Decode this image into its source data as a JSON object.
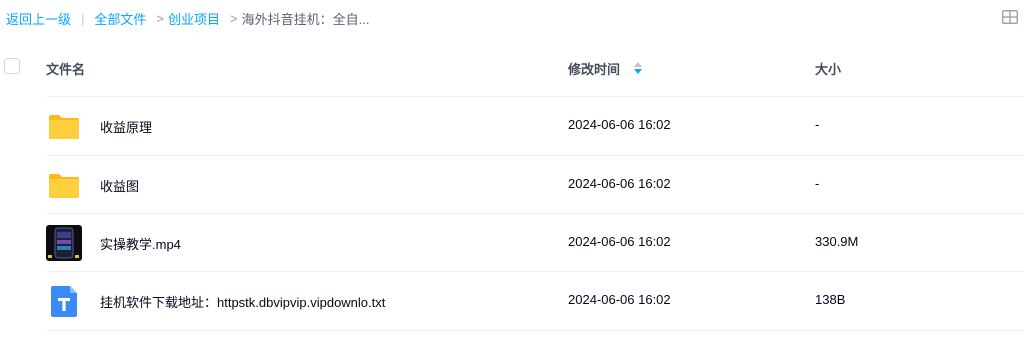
{
  "breadcrumb": {
    "back": "返回上一级",
    "sep": "|",
    "all_files": "全部文件",
    "gt": ">",
    "folder1": "创业项目",
    "current": "海外抖音挂机：全自..."
  },
  "view_toggle_icon": "grid-view-icon",
  "table": {
    "columns": {
      "name": "文件名",
      "modified": "修改时间",
      "size": "大小"
    },
    "sort_icon": "sort-toggle-icon",
    "rows": [
      {
        "icon": "folder-icon",
        "name": "收益原理",
        "modified": "2024-06-06 16:02",
        "size": "-"
      },
      {
        "icon": "folder-icon",
        "name": "收益图",
        "modified": "2024-06-06 16:02",
        "size": "-"
      },
      {
        "icon": "video-thumbnail-icon",
        "name": "实操教学.mp4",
        "modified": "2024-06-06 16:02",
        "size": "330.9M"
      },
      {
        "icon": "text-file-icon",
        "name": "挂机软件下载地址：httpstk.dbvipvip.vipdownlo.txt",
        "modified": "2024-06-06 16:02",
        "size": "138B"
      }
    ]
  },
  "colors": {
    "accent": "#06a7ff",
    "folder": "#ffc82c",
    "txt_icon": "#3d8af7"
  }
}
